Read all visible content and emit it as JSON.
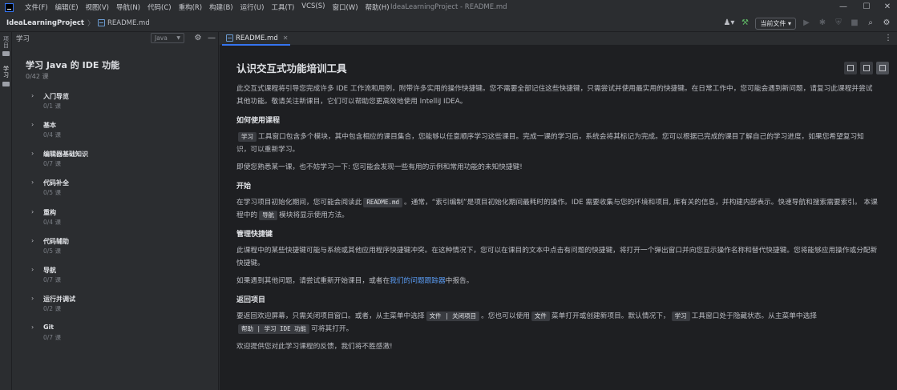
{
  "menu": {
    "items": [
      "文件(F)",
      "编辑(E)",
      "视图(V)",
      "导航(N)",
      "代码(C)",
      "重构(R)",
      "构建(B)",
      "运行(U)",
      "工具(T)",
      "VCS(S)",
      "窗口(W)",
      "帮助(H)"
    ]
  },
  "window": {
    "title": "IdeaLearningProject - README.md"
  },
  "nav": {
    "project": "IdeaLearningProject",
    "separator": "〉",
    "file": "README.md",
    "run_config": "当前文件"
  },
  "toolstrip": {
    "project_label": "项目",
    "learn_label": "学习"
  },
  "learn": {
    "header_title": "学习",
    "language": "Java",
    "course_title": "学习 Java 的 IDE 功能",
    "course_progress": "0/42 课",
    "modules": [
      {
        "name": "入门导览",
        "count": "0/1 课"
      },
      {
        "name": "基本",
        "count": "0/4 课"
      },
      {
        "name": "编辑器基础知识",
        "count": "0/7 课"
      },
      {
        "name": "代码补全",
        "count": "0/5 课"
      },
      {
        "name": "重构",
        "count": "0/4 课"
      },
      {
        "name": "代码辅助",
        "count": "0/5 课"
      },
      {
        "name": "导航",
        "count": "0/7 课"
      },
      {
        "name": "运行并调试",
        "count": "0/2 课"
      },
      {
        "name": "Git",
        "count": "0/7 课"
      }
    ]
  },
  "editor": {
    "tab_label": "README.md",
    "doc": {
      "title": "认识交互式功能培训工具",
      "p1": "此交互式课程将引导您完成许多 IDE 工作流和用例，附带许多实用的操作快捷键。您不需要全部记住这些快捷键，只需尝试并使用最实用的快捷键。在日常工作中，您可能会遇到新问题，请复习此课程并尝试其他功能。敬请关注新课目，它们可以帮助您更高效地使用 IntelliJ IDEA。",
      "h_how": "如何使用课程",
      "how_code": "学习",
      "how_text": "工具窗口包含多个模块，其中包含相应的课目集合，您能够以任意顺序学习这些课目。完成一课的学习后，系统会将其标记为完成。您可以根据已完成的课目了解自己的学习进度，如果您希望复习知识，可以重新学习。",
      "p_familiar": "即使您熟悉某一课，也不妨学习一下: 您可能会发现一些有用的示例和常用功能的未知快捷键!",
      "h_start": "开始",
      "start_text1": "在学习项目初始化期间，您可能会阅读此",
      "start_code1": "README.md",
      "start_text2": "。通常，“索引编制”是项目初始化期间最耗时的操作。IDE 需要收集与您的环境和项目, 库有关的信息，并构建内部表示。快速导航和搜索需要索引。 本课程中的",
      "start_code2": "导航",
      "start_text3": "模块将显示使用方法。",
      "h_shortcuts": "管理快捷键",
      "shortcuts_text": "此课程中的某些快捷键可能与系统或其他应用程序快捷键冲突。在这种情况下，您可以在课目的文本中点击有问题的快捷键，将打开一个弹出窗口并向您显示操作名称和替代快捷键。您将能够应用操作或分配新快捷键。",
      "issue_text1": "如果遇到其他问题，请尝试重新开始课目，或者在",
      "issue_link": "我们的问题跟踪器",
      "issue_text2": "中报告。",
      "h_return": "返回项目",
      "return_text1": "要返回欢迎屏幕，只需关闭项目窗口。或者，从主菜单中选择",
      "return_code1": "文件 | 关闭项目",
      "return_text2": "。您也可以使用",
      "return_code2": "文件",
      "return_text3": "菜单打开或创建新项目。默认情况下，",
      "return_code3": "学习",
      "return_text4": "工具窗口处于隐藏状态。从主菜单中选择",
      "return_code4": "帮助 | 学习 IDE 功能",
      "return_text5": "可将其打开。",
      "p_feedback": "欢迎提供您对此学习课程的反馈，我们将不胜感激!"
    }
  }
}
